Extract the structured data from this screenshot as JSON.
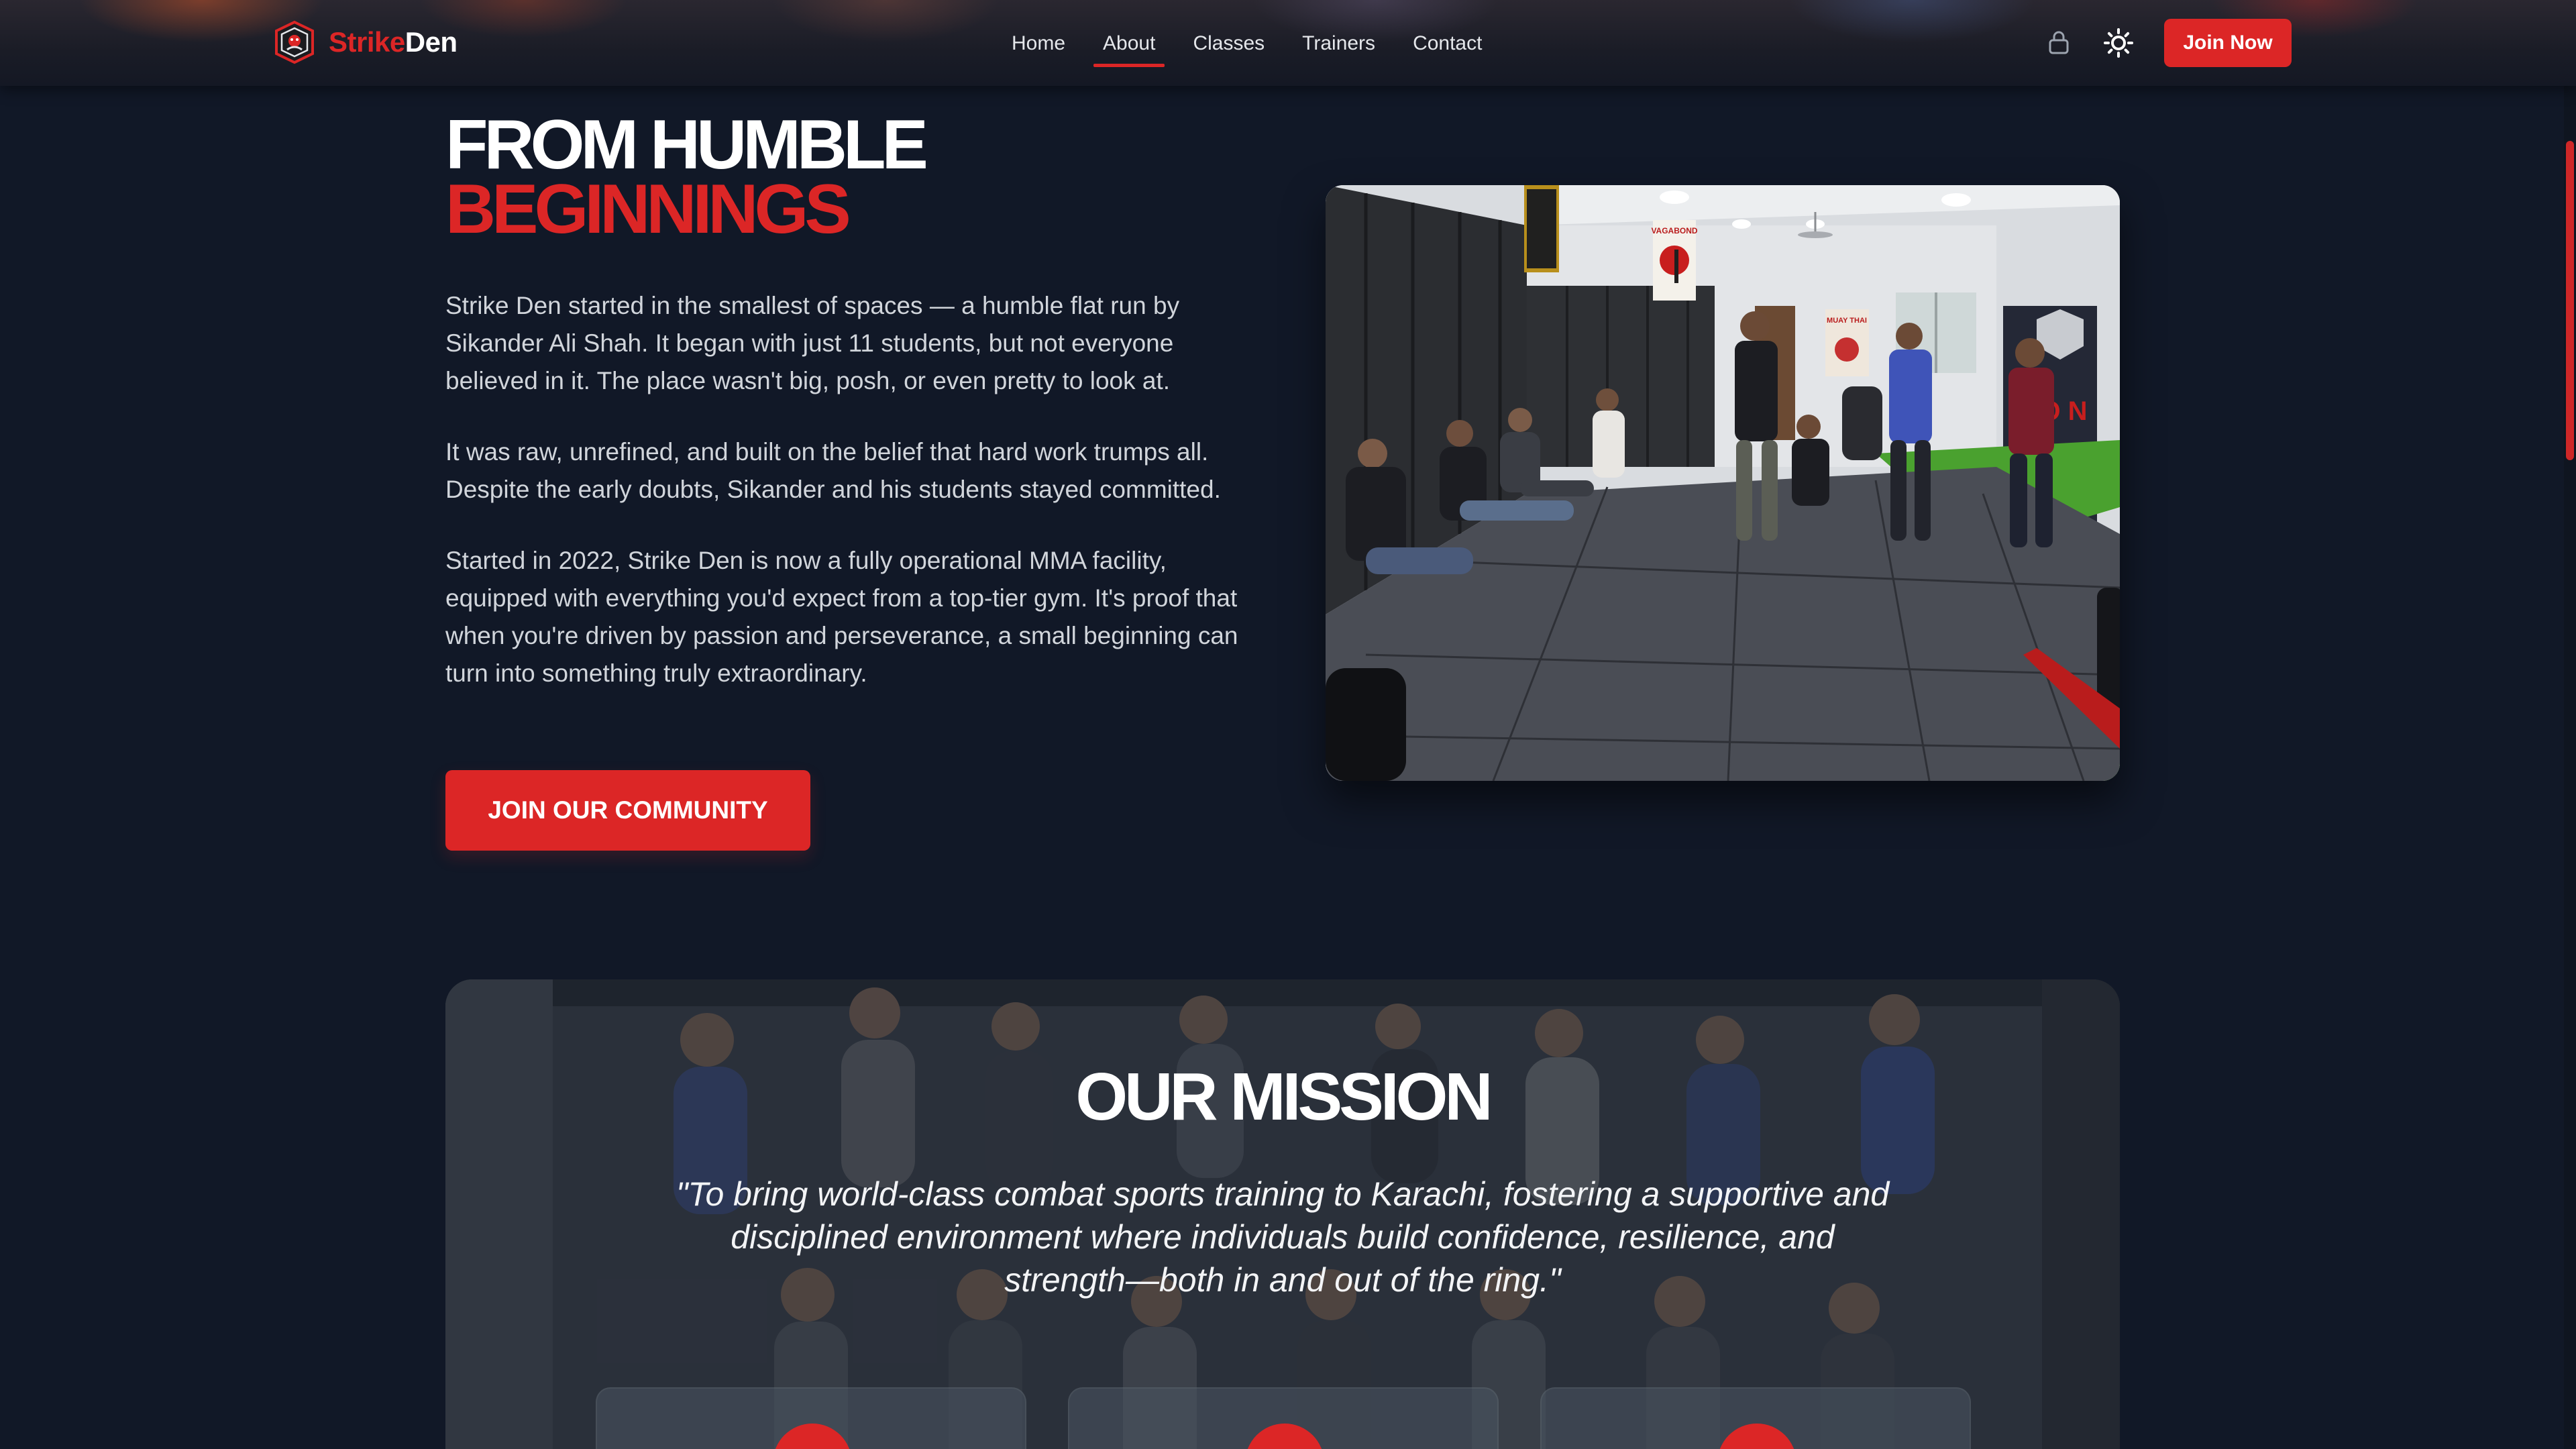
{
  "brand": {
    "name_part1": "Strike",
    "name_part2": "Den",
    "logo_icon": "shield-logo-icon"
  },
  "nav": {
    "items": [
      {
        "label": "Home",
        "active": false
      },
      {
        "label": "About",
        "active": true
      },
      {
        "label": "Classes",
        "active": false
      },
      {
        "label": "Trainers",
        "active": false
      },
      {
        "label": "Contact",
        "active": false
      }
    ],
    "lock_icon": "lock-icon",
    "theme_icon": "sun-icon",
    "cta_label": "Join Now"
  },
  "hero": {
    "title_line1": "FROM HUMBLE",
    "title_line2": "BEGINNINGS",
    "paragraphs": [
      "Strike Den started in the smallest of spaces — a humble flat run by Sikander Ali Shah. It began with just 11 students, but not everyone believed in it. The place wasn't big, posh, or even pretty to look at.",
      "It was raw, unrefined, and built on the belief that hard work trumps all. Despite the early doubts, Sikander and his students stayed committed.",
      "Started in 2022, Strike Den is now a fully operational MMA facility, equipped with everything you'd expect from a top-tier gym. It's proof that when you're driven by passion and perseverance, a small beginning can turn into something truly extraordinary."
    ],
    "cta_label": "JOIN OUR COMMUNITY",
    "photo_posters": [
      "VAGABOND",
      "MUAY THAI"
    ]
  },
  "mission": {
    "title": "OUR MISSION",
    "quote": "\"To bring world-class combat sports training to Karachi, fostering a supportive and disciplined environment where individuals build confidence, resilience, and strength—both in and out of the ring.\""
  },
  "colors": {
    "background": "#111827",
    "accent": "#dc2626",
    "text_primary": "#ffffff",
    "text_body": "#d1d5db"
  }
}
